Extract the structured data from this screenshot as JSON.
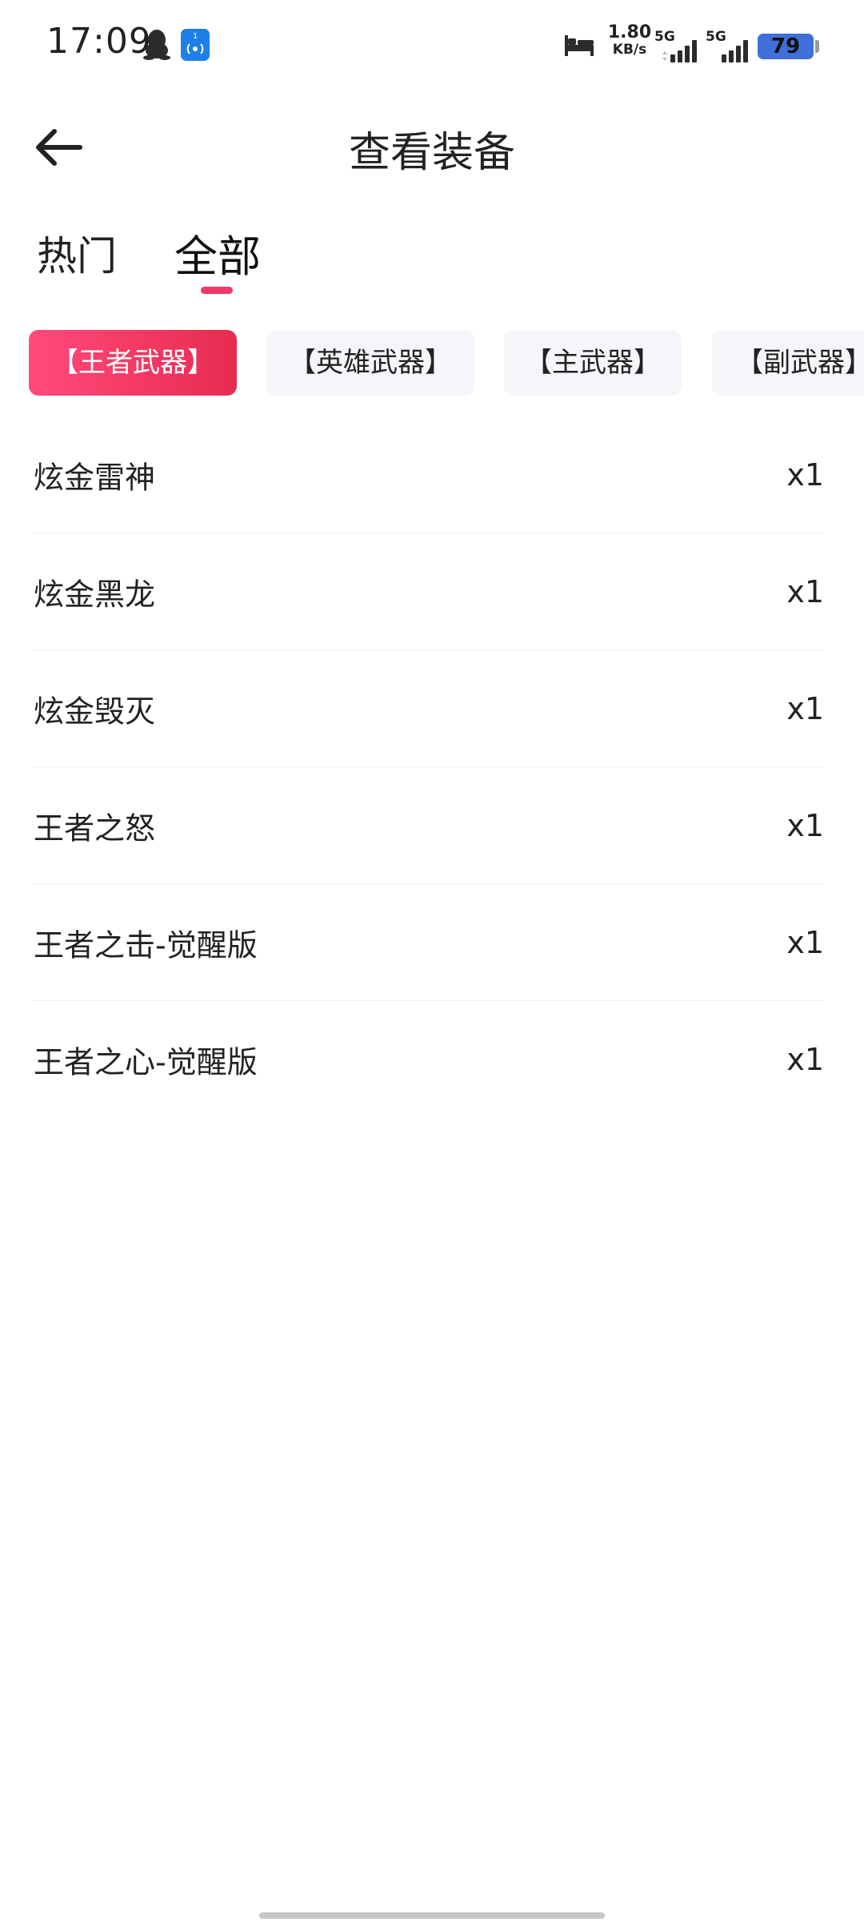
{
  "status_bar": {
    "time": "17:09",
    "hotspot_count": "1",
    "net_speed_value": "1.80",
    "net_speed_unit": "KB/s",
    "signal1_label": "5G",
    "signal2_label": "5G",
    "battery": "79",
    "icons": [
      "qq-icon",
      "hotspot-icon",
      "bed-icon",
      "signal-icon",
      "battery-icon"
    ]
  },
  "header": {
    "title": "查看装备",
    "back_icon": "back-arrow-icon"
  },
  "tabs": [
    {
      "label": "热门",
      "active": false
    },
    {
      "label": "全部",
      "active": true
    }
  ],
  "chips": [
    {
      "label": "【王者武器】",
      "active": true
    },
    {
      "label": "【英雄武器】",
      "active": false
    },
    {
      "label": "【主武器】",
      "active": false
    },
    {
      "label": "【副武器】",
      "active": false
    }
  ],
  "items": [
    {
      "name": "炫金雷神",
      "qty": "x1"
    },
    {
      "name": "炫金黑龙",
      "qty": "x1"
    },
    {
      "name": "炫金毁灭",
      "qty": "x1"
    },
    {
      "name": "王者之怒",
      "qty": "x1"
    },
    {
      "name": "王者之击-觉醒版",
      "qty": "x1"
    },
    {
      "name": "王者之心-觉醒版",
      "qty": "x1"
    }
  ],
  "colors": {
    "accent": "#f0386b",
    "chip_bg": "#f4f6f9",
    "battery": "#3f6fd8",
    "hotspot": "#1e7fe8"
  }
}
